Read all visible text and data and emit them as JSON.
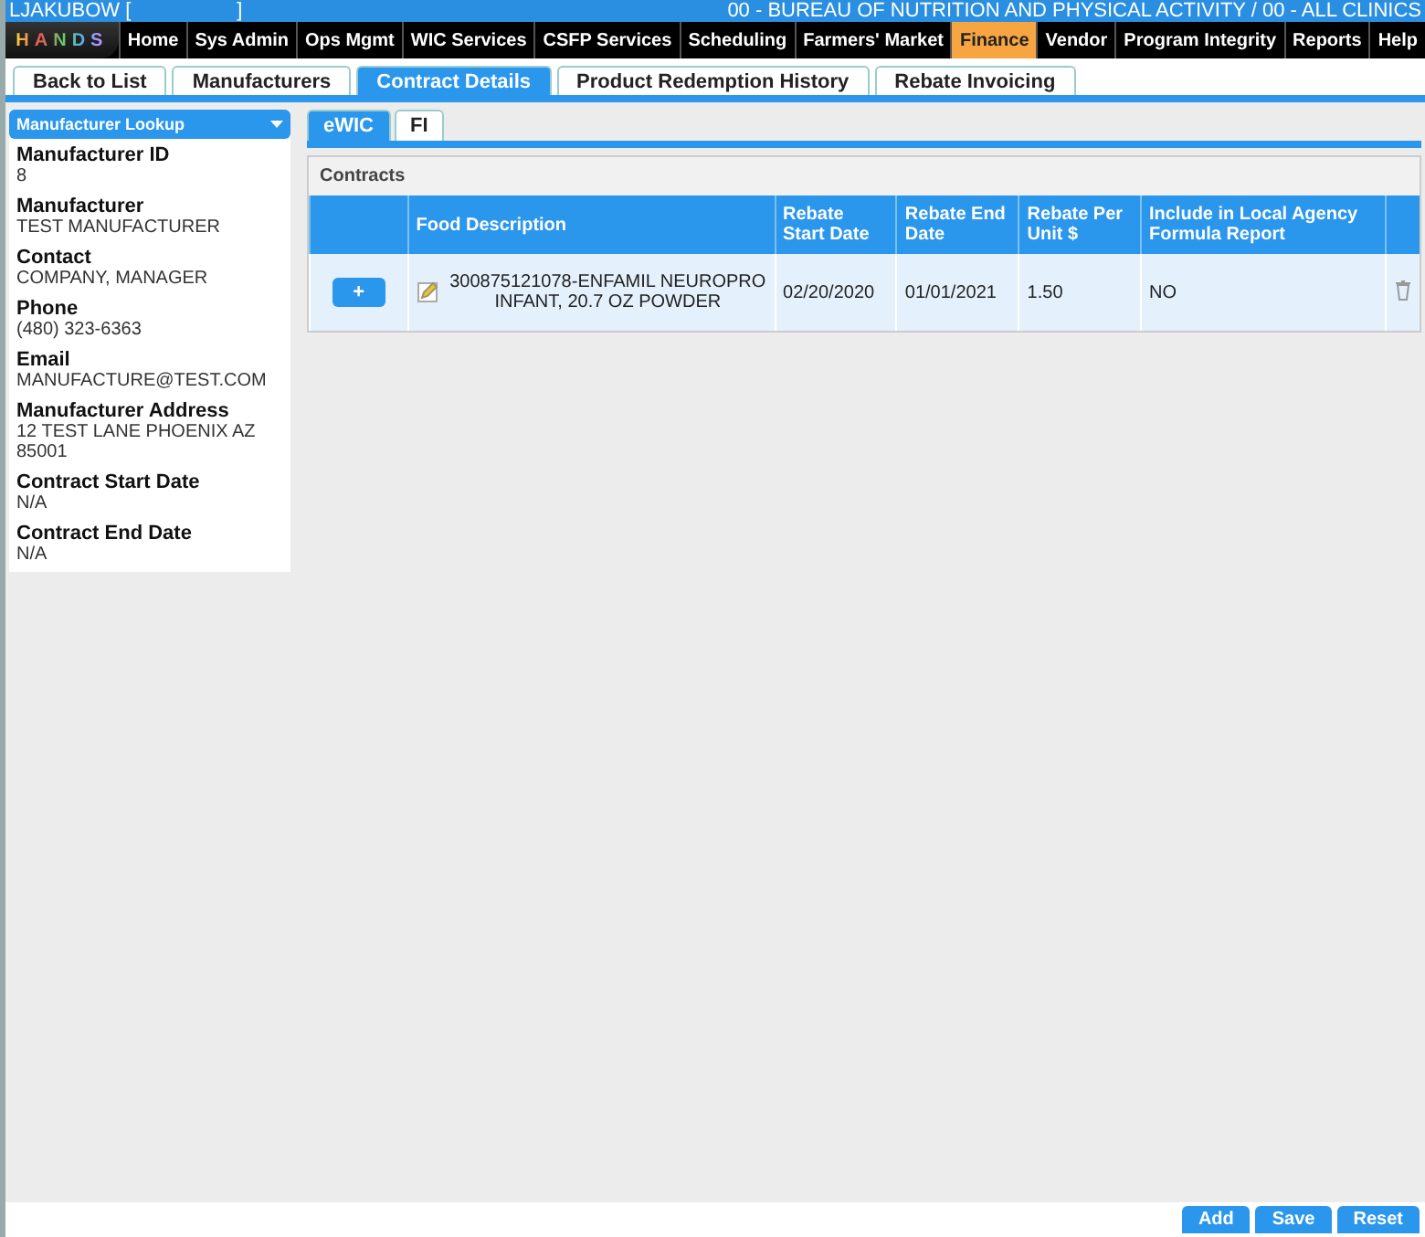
{
  "header": {
    "user": "LJAKUBOW [",
    "user_end": "]",
    "agency": "00 - BUREAU OF NUTRITION AND PHYSICAL ACTIVITY / 00 - ALL CLINICS",
    "logo": "HANDS"
  },
  "menu": [
    {
      "label": "Home",
      "selected": false
    },
    {
      "label": "Sys Admin",
      "selected": false
    },
    {
      "label": "Ops Mgmt",
      "selected": false
    },
    {
      "label": "WIC Services",
      "selected": false
    },
    {
      "label": "CSFP Services",
      "selected": false
    },
    {
      "label": "Scheduling",
      "selected": false
    },
    {
      "label": "Farmers' Market",
      "selected": false
    },
    {
      "label": "Finance",
      "selected": true
    },
    {
      "label": "Vendor",
      "selected": false
    },
    {
      "label": "Program Integrity",
      "selected": false
    },
    {
      "label": "Reports",
      "selected": false
    },
    {
      "label": "Help",
      "selected": false
    }
  ],
  "tabs": [
    {
      "label": "Back to List",
      "selected": false
    },
    {
      "label": "Manufacturers",
      "selected": false
    },
    {
      "label": "Contract Details",
      "selected": true
    },
    {
      "label": "Product Redemption History",
      "selected": false
    },
    {
      "label": "Rebate Invoicing",
      "selected": false
    }
  ],
  "sidebar": {
    "lookup": "Manufacturer Lookup",
    "fields": [
      {
        "label": "Manufacturer ID",
        "value": "8"
      },
      {
        "label": "Manufacturer",
        "value": "TEST MANUFACTURER"
      },
      {
        "label": "Contact",
        "value": "COMPANY, MANAGER"
      },
      {
        "label": "Phone",
        "value": "(480) 323-6363"
      },
      {
        "label": "Email",
        "value": "MANUFACTURE@TEST.COM"
      },
      {
        "label": "Manufacturer Address",
        "value": "12 TEST LANE PHOENIX AZ 85001"
      },
      {
        "label": "Contract Start Date",
        "value": "N/A"
      },
      {
        "label": "Contract End Date",
        "value": "N/A"
      }
    ]
  },
  "subtabs": [
    {
      "label": "eWIC",
      "selected": true
    },
    {
      "label": "FI",
      "selected": false
    }
  ],
  "contracts": {
    "title": "Contracts",
    "columns": [
      "Food Description",
      "Rebate Start Date",
      "Rebate End Date",
      "Rebate Per Unit $",
      "Include in Local Agency Formula Report"
    ],
    "rows": [
      {
        "expand": "+",
        "food": "300875121078-ENFAMIL NEUROPRO INFANT, 20.7 OZ POWDER",
        "start": "02/20/2020",
        "end": "01/01/2021",
        "rebate": "1.50",
        "include": "NO"
      }
    ]
  },
  "buttons": [
    "Add",
    "Save",
    "Reset"
  ]
}
